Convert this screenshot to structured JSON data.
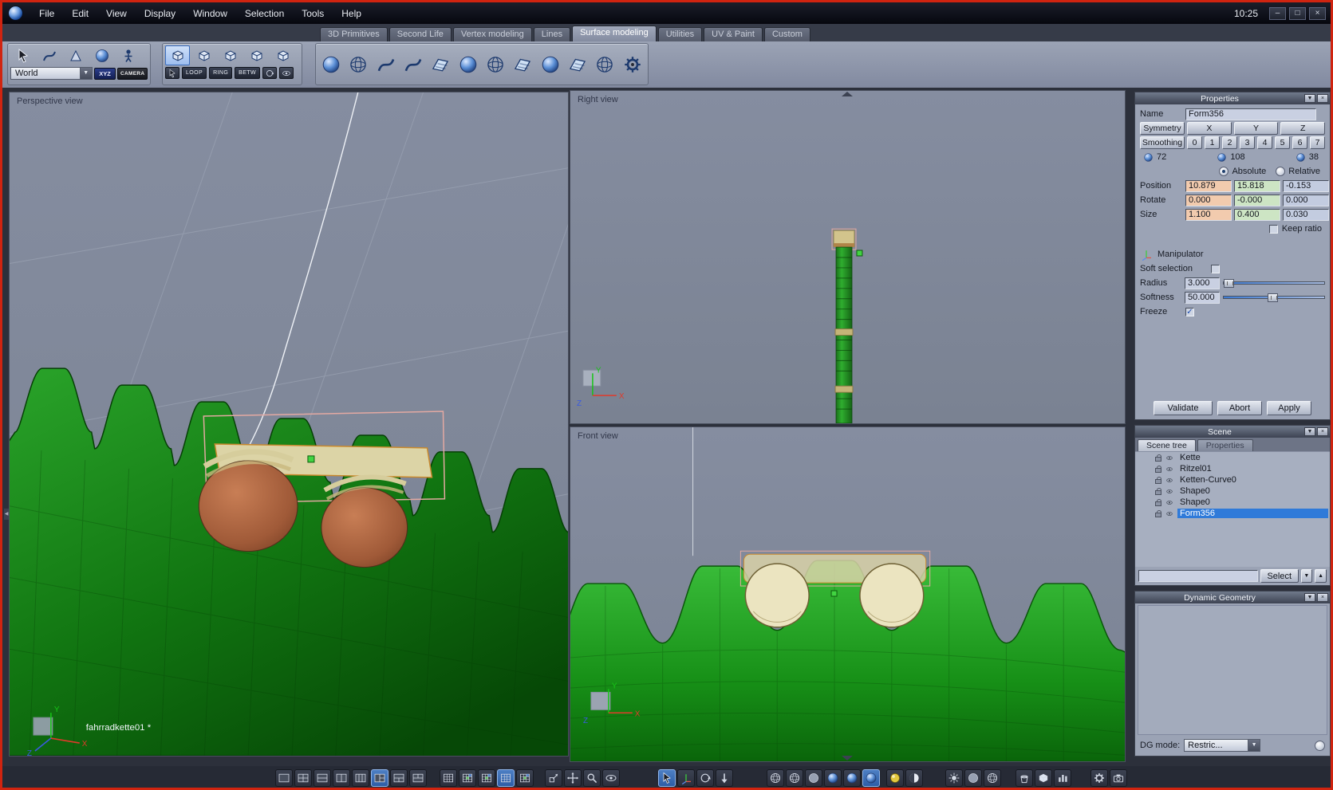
{
  "menubar": {
    "items": [
      "File",
      "Edit",
      "View",
      "Display",
      "Window",
      "Selection",
      "Tools",
      "Help"
    ],
    "time": "10:25"
  },
  "icons": {
    "dropdown": "▼",
    "up": "▲",
    "close": "×",
    "minimize": "–",
    "maximize": "□",
    "check": "✓",
    "splitter_up": "▲",
    "splitter_down": "▼",
    "splitter_left": "◀"
  },
  "tabs": {
    "items": [
      "3D Primitives",
      "Second Life",
      "Vertex modeling",
      "Lines",
      "Surface modeling",
      "Utilities",
      "UV & Paint",
      "Custom"
    ],
    "active": "Surface modeling",
    "active_index": 4
  },
  "toolbar": {
    "world_label": "World",
    "xyz_label": "XYZ",
    "camera_label": "CAMERA",
    "loop_label": "LOOP",
    "ring_label": "RING",
    "betw_label": "BETW"
  },
  "viewports": {
    "perspective": {
      "label": "Perspective view",
      "object_label": "fahrradkette01 *"
    },
    "right": {
      "label": "Right view"
    },
    "front": {
      "label": "Front view"
    },
    "axis": {
      "x": "X",
      "y": "Y",
      "z": "Z"
    }
  },
  "properties": {
    "title": "Properties",
    "name_label": "Name",
    "name_value": "Form356",
    "symmetry_label": "Symmetry",
    "axis_x": "X",
    "axis_y": "Y",
    "axis_z": "Z",
    "smoothing_label": "Smoothing",
    "smoothing_levels": [
      "0",
      "1",
      "2",
      "3",
      "4",
      "5",
      "6",
      "7"
    ],
    "count_1": "72",
    "count_2": "108",
    "count_3": "38",
    "absolute_label": "Absolute",
    "relative_label": "Relative",
    "position_label": "Position",
    "position_x": "10.879",
    "position_y": "15.818",
    "position_z": "-0.153",
    "rotate_label": "Rotate",
    "rotate_x": "0.000",
    "rotate_y": "-0.000",
    "rotate_z": "0.000",
    "size_label": "Size",
    "size_x": "1.100",
    "size_y": "0.400",
    "size_z": "0.030",
    "keep_ratio_label": "Keep ratio",
    "manipulator_label": "Manipulator",
    "soft_selection_label": "Soft selection",
    "radius_label": "Radius",
    "radius_value": "3.000",
    "softness_label": "Softness",
    "softness_value": "50.000",
    "freeze_label": "Freeze",
    "freeze_checked": true,
    "validate_label": "Validate",
    "abort_label": "Abort",
    "apply_label": "Apply"
  },
  "scene": {
    "title": "Scene",
    "tree_tab": "Scene tree",
    "properties_tab": "Properties",
    "items": [
      "Kette",
      "Ritzel01",
      "Ketten-Curve0",
      "Shape0",
      "Shape0",
      "Form356"
    ],
    "selected_index": 5,
    "filter_value": "",
    "select_label": "Select"
  },
  "dynamic_geometry": {
    "title": "Dynamic Geometry",
    "dg_mode_label": "DG mode:",
    "dg_mode_value": "Restric..."
  }
}
